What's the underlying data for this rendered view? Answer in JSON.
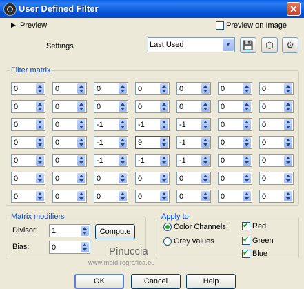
{
  "window": {
    "title": "User Defined Filter",
    "close_glyph": "✕"
  },
  "preview": {
    "label": "Preview",
    "toggle_glyph": "▶",
    "preview_on_image": {
      "label": "Preview on Image",
      "checked": false
    }
  },
  "settings": {
    "label": "Settings",
    "preset_value": "Last Used",
    "dropdown_glyph": "▼",
    "tools": [
      {
        "icon": "save-icon",
        "glyph": "💾"
      },
      {
        "icon": "cube-icon",
        "glyph": "⬡"
      },
      {
        "icon": "preset-manager-icon",
        "glyph": "⚙"
      }
    ]
  },
  "filter_matrix": {
    "title": "Filter matrix",
    "rows": [
      [
        "0",
        "0",
        "0",
        "0",
        "0",
        "0",
        "0"
      ],
      [
        "0",
        "0",
        "0",
        "0",
        "0",
        "0",
        "0"
      ],
      [
        "0",
        "0",
        "-1",
        "-1",
        "-1",
        "0",
        "0"
      ],
      [
        "0",
        "0",
        "-1",
        "9",
        "-1",
        "0",
        "0"
      ],
      [
        "0",
        "0",
        "-1",
        "-1",
        "-1",
        "0",
        "0"
      ],
      [
        "0",
        "0",
        "0",
        "0",
        "0",
        "0",
        "0"
      ],
      [
        "0",
        "0",
        "0",
        "0",
        "0",
        "0",
        "0"
      ]
    ]
  },
  "matrix_modifiers": {
    "title": "Matrix modifiers",
    "divisor_label": "Divisor:",
    "divisor_value": "1",
    "compute_label": "Compute",
    "bias_label": "Bias:",
    "bias_value": "0"
  },
  "apply_to": {
    "title": "Apply to",
    "color_channels": {
      "label": "Color Channels:",
      "selected": true
    },
    "grey_values": {
      "label": "Grey values",
      "selected": false
    },
    "channels": [
      {
        "label": "Red",
        "checked": true
      },
      {
        "label": "Green",
        "checked": true
      },
      {
        "label": "Blue",
        "checked": true
      }
    ]
  },
  "watermark": {
    "name": "Pinuccia",
    "url": "www.maidiregrafica.eu"
  },
  "buttons": {
    "ok": "OK",
    "cancel": "Cancel",
    "help": "Help"
  }
}
